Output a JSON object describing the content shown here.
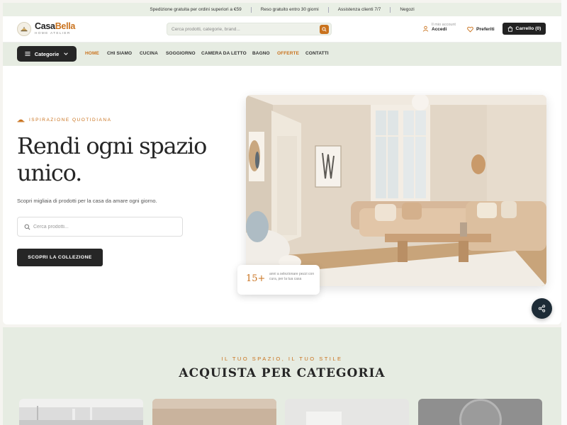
{
  "topbar": {
    "messages": [
      "Spedizione gratuita per ordini superiori a €59",
      "Reso gratuito entro 30 giorni",
      "Assistenza clienti 7/7",
      "Negozi"
    ]
  },
  "header": {
    "logo_name_a": "Casa",
    "logo_name_b": "Bella",
    "logo_sub": "Home Atelier",
    "search_placeholder": "Cerca prodotti, categorie, brand...",
    "account_small": "Il mio account",
    "account_action": "Accedi",
    "favorites": "Preferiti",
    "cart": "Carrello (0)"
  },
  "nav": {
    "categories_button": "Categorie",
    "items": [
      {
        "label": "HOME",
        "highlight": true
      },
      {
        "label": "CHI SIAMO",
        "highlight": false
      },
      {
        "label": "CUCINA",
        "highlight": false
      },
      {
        "label": "SOGGIORNO",
        "highlight": false
      },
      {
        "label": "CAMERA DA LETTO",
        "highlight": false
      },
      {
        "label": "BAGNO",
        "highlight": false
      },
      {
        "label": "OFFERTE",
        "highlight": true
      },
      {
        "label": "CONTATTI",
        "highlight": false
      }
    ]
  },
  "hero": {
    "eyebrow": "ISPIRAZIONE QUOTIDIANA",
    "title_line1": "Rendi ogni spazio",
    "title_line2": "unico.",
    "subtitle": "Scopri migliaia di prodotti per la casa da amare ogni giorno.",
    "search_placeholder": "Cerca prodotti...",
    "cta": "SCOPRI LA COLLEZIONE",
    "badge_number": "15+",
    "badge_text": "anni a selezionare pezzi con cura, per la tua casa"
  },
  "categories_section": {
    "eyebrow": "IL TUO SPAZIO, IL TUO STILE",
    "title": "ACQUISTA PER CATEGORIA"
  },
  "colors": {
    "accent": "#c9721d",
    "dark": "#262626",
    "sage": "#e6ece2",
    "share_button": "#1d2b36"
  },
  "icons": [
    "cloche-icon",
    "search-icon",
    "user-icon",
    "heart-icon",
    "cart-icon",
    "menu-icon",
    "chevron-down-icon",
    "share-icon"
  ]
}
